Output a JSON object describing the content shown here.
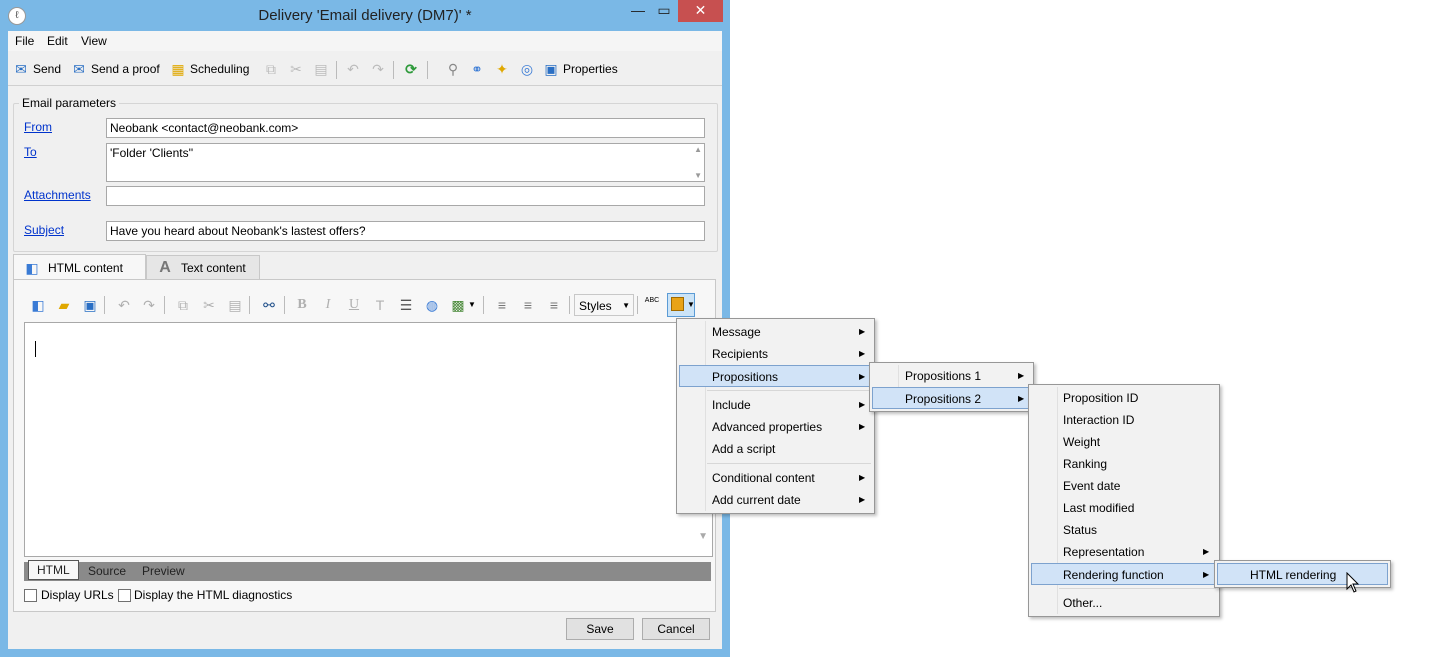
{
  "window": {
    "title": "Delivery 'Email delivery (DM7)' *",
    "minimize": "—",
    "maximize": "▭",
    "close": "✕",
    "app_icon": "ℓ"
  },
  "menubar": [
    "File",
    "Edit",
    "View"
  ],
  "toolbar": {
    "send": "Send",
    "send_proof": "Send a proof",
    "scheduling": "Scheduling",
    "properties": "Properties"
  },
  "email": {
    "group_title": "Email parameters",
    "from_label": "From",
    "from_value": "Neobank <contact@neobank.com>",
    "to_label": "To",
    "to_value": "'Folder 'Clients''",
    "attachments_label": "Attachments",
    "attachments_value": "",
    "subject_label": "Subject",
    "subject_value": "Have you heard about Neobank's lastest offers?"
  },
  "tabs": {
    "html": "HTML content",
    "text": "Text content"
  },
  "editor_toolbar": {
    "styles": "Styles",
    "bold": "B",
    "italic": "I",
    "underline": "U",
    "spell": "ABC"
  },
  "mode_tabs": [
    "HTML",
    "Source",
    "Preview"
  ],
  "options": {
    "display_urls": "Display URLs",
    "html_diagnostics": "Display the HTML diagnostics"
  },
  "buttons": {
    "save": "Save",
    "cancel": "Cancel"
  },
  "menu1": {
    "items": [
      "Message",
      "Recipients",
      "Propositions",
      "Include",
      "Advanced properties",
      "Add a script",
      "Conditional content",
      "Add current date"
    ],
    "highlighted": "Propositions"
  },
  "menu2": {
    "items": [
      "Propositions 1",
      "Propositions 2"
    ],
    "highlighted": "Propositions 2"
  },
  "menu3": {
    "items": [
      "Proposition ID",
      "Interaction ID",
      "Weight",
      "Ranking",
      "Event date",
      "Last modified",
      "Status",
      "Representation",
      "Rendering function",
      "Other..."
    ],
    "highlighted": "Rendering function"
  },
  "menu4": {
    "items": [
      "HTML rendering"
    ],
    "highlighted": "HTML rendering"
  },
  "colors": {
    "title_bar": "#7ab8e6",
    "close_button": "#c75050",
    "link": "#0033cc",
    "menu_highlight": "#d1e3f7"
  }
}
